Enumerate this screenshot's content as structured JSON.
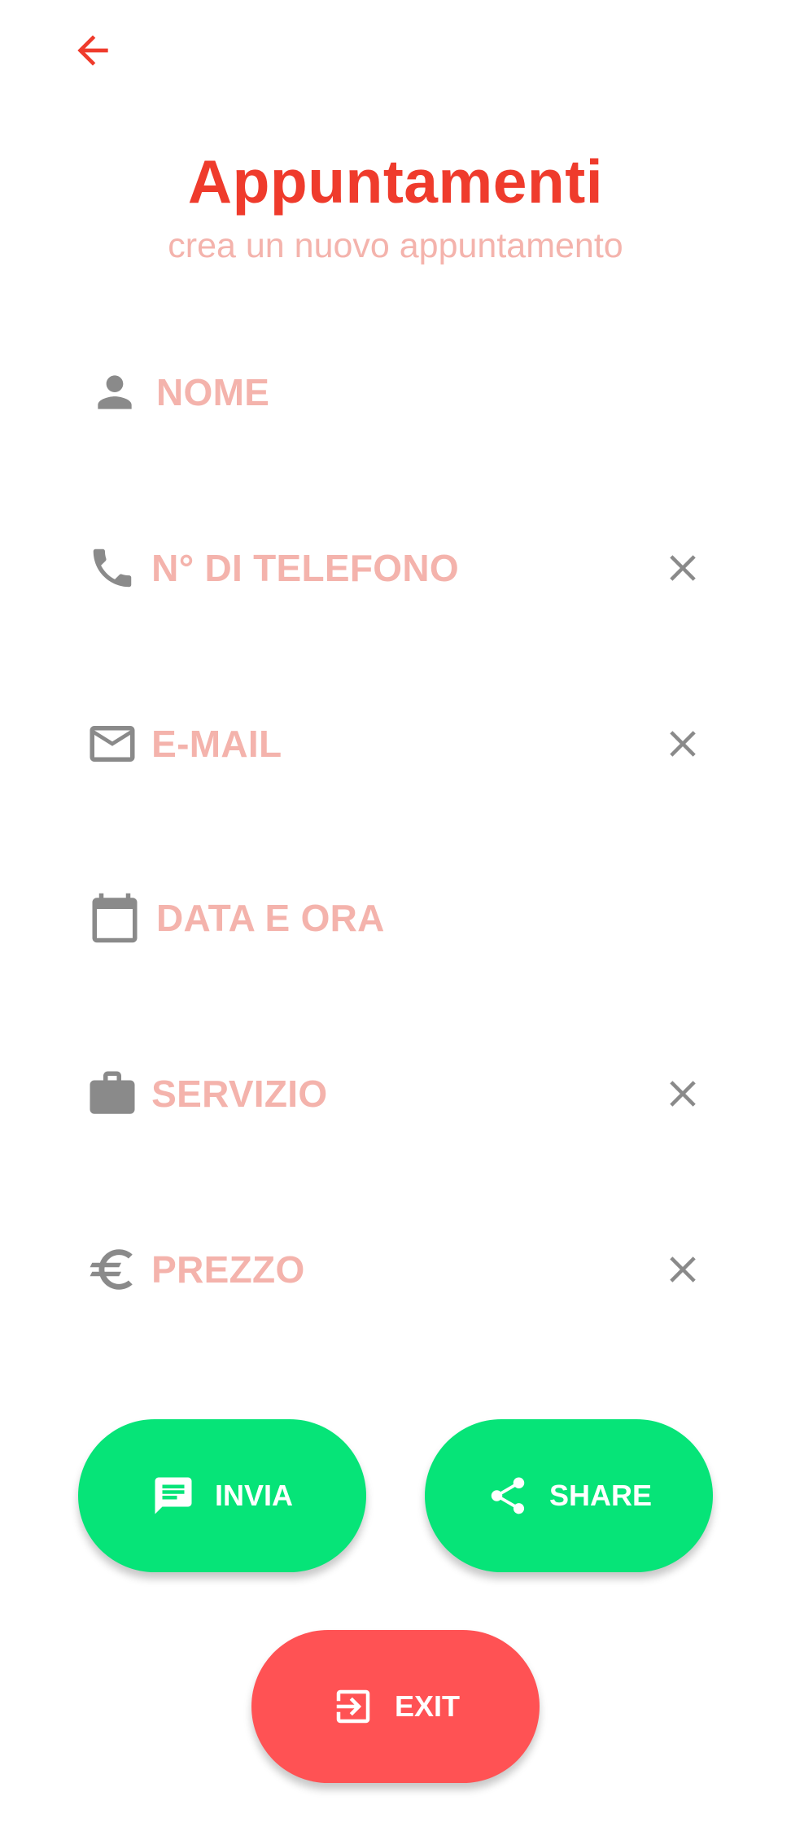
{
  "colors": {
    "accent": "#ef3b2c",
    "placeholder": "#f4b3ac",
    "icon": "#8a8a8a",
    "green": "#06e478",
    "red": "#ff5254"
  },
  "header": {
    "back_icon": "arrow-back-icon",
    "title": "Appuntamenti",
    "subtitle": "crea un nuovo appuntamento"
  },
  "form": {
    "name": {
      "placeholder": "NOME",
      "icon": "person-icon"
    },
    "phone": {
      "placeholder": "N° DI TELEFONO",
      "icon": "phone-icon"
    },
    "email": {
      "placeholder": "E-MAIL",
      "icon": "mail-icon"
    },
    "datetime": {
      "placeholder": "DATA E ORA",
      "icon": "calendar-icon"
    },
    "service": {
      "placeholder": "SERVIZIO",
      "icon": "briefcase-icon"
    },
    "price": {
      "placeholder": "PREZZO",
      "icon": "euro-icon"
    }
  },
  "actions": {
    "send_label": "INVIA",
    "share_label": "SHARE",
    "exit_label": "EXIT"
  }
}
